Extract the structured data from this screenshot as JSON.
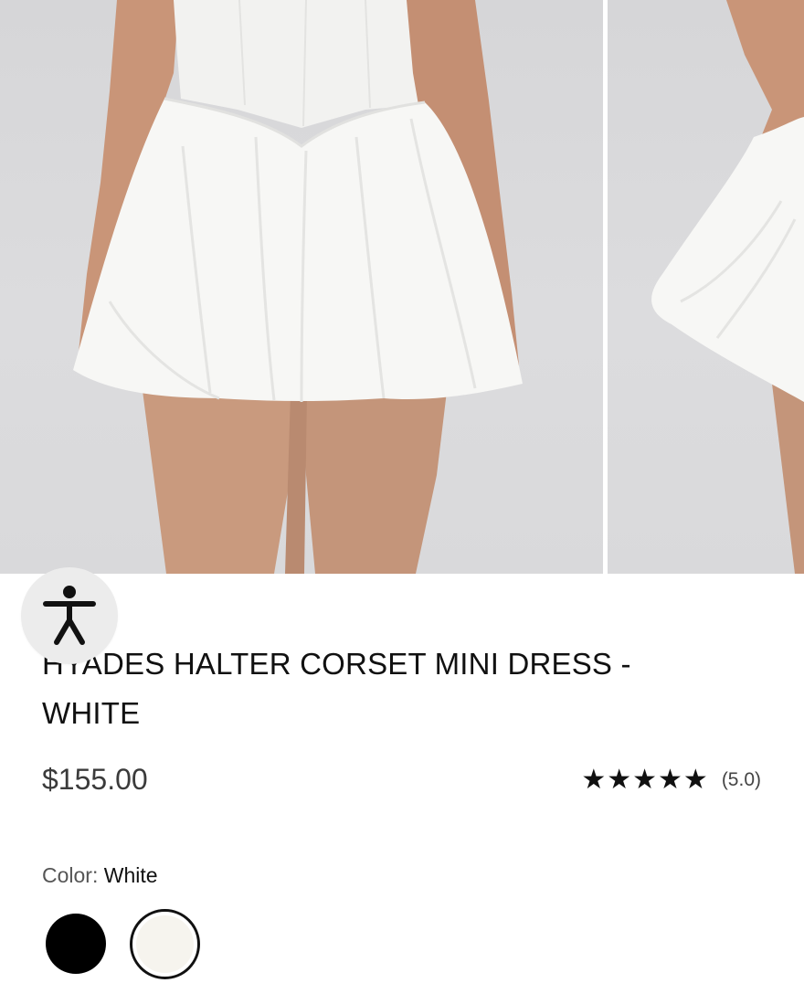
{
  "product": {
    "title": "HYADES HALTER CORSET MINI DRESS - WHITE",
    "price": "$155.00",
    "rating_stars": "★★★★★",
    "rating_value": "(5.0)"
  },
  "color": {
    "label": "Color:",
    "selected": "White",
    "options": [
      {
        "name": "Black",
        "hex": "#000000"
      },
      {
        "name": "White",
        "hex": "#f6f4ee"
      }
    ]
  },
  "icons": {
    "accessibility": "accessibility-icon",
    "star": "star-icon"
  },
  "colors": {
    "background": "#ffffff",
    "text": "#111111",
    "accessibility_button": "#ececec"
  }
}
